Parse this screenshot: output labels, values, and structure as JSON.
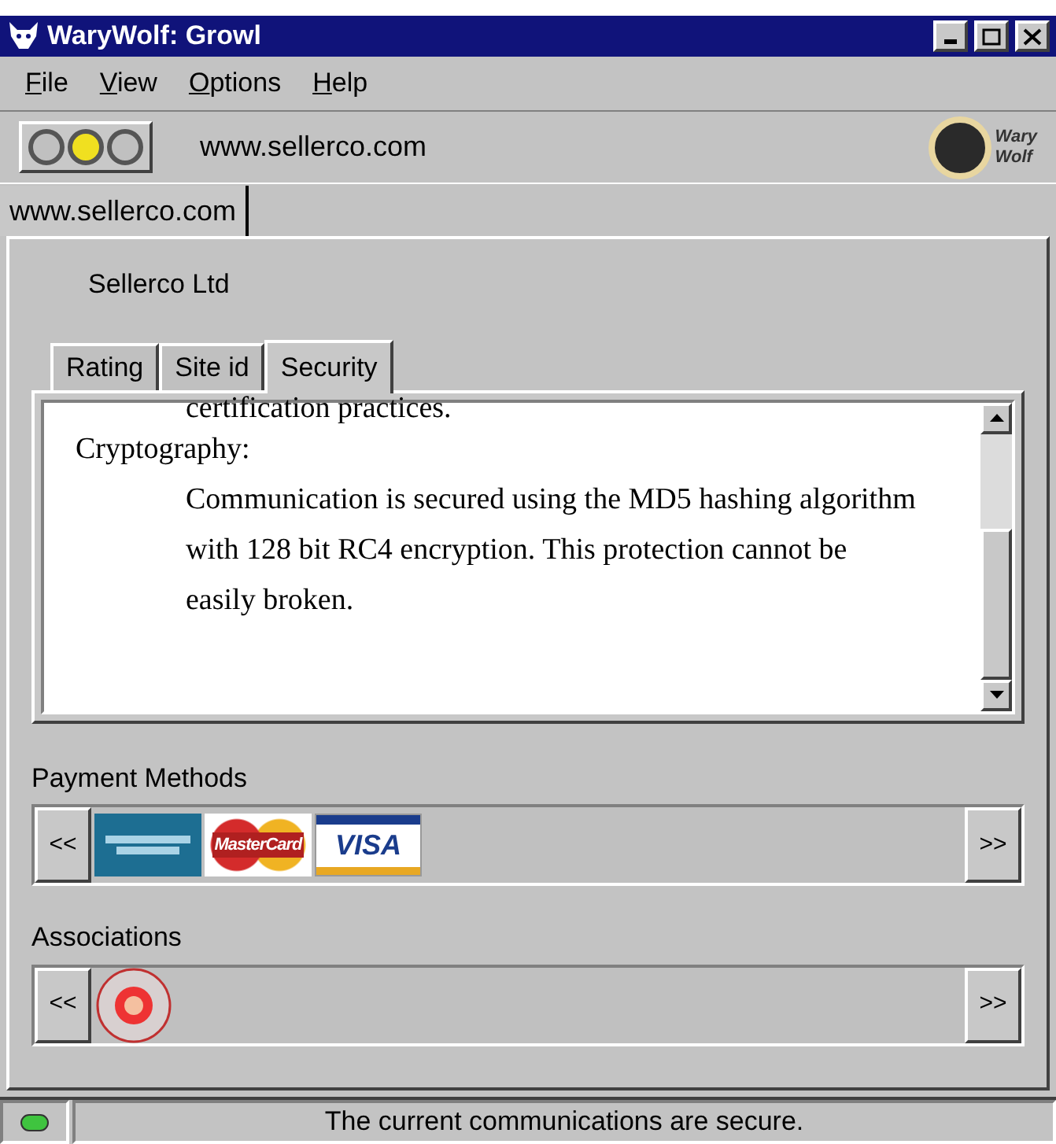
{
  "window": {
    "title": "WaryWolf: Growl"
  },
  "menu": [
    {
      "label": "File"
    },
    {
      "label": "View"
    },
    {
      "label": "Options"
    },
    {
      "label": "Help"
    }
  ],
  "toolbar": {
    "lights": [
      {
        "on": false
      },
      {
        "on": true
      },
      {
        "on": false
      }
    ],
    "url": "www.sellerco.com",
    "logo_text": [
      "Wary",
      "Wolf"
    ]
  },
  "site_tab": {
    "label": "www.sellerco.com"
  },
  "company": "Sellerco Ltd",
  "tabs": [
    {
      "label": "Rating",
      "selected": false
    },
    {
      "label": "Site id",
      "selected": false
    },
    {
      "label": "Security",
      "selected": true
    }
  ],
  "security": {
    "clipped_line": "certification practices.",
    "heading": "Cryptography:",
    "body": "Communication is secured using the MD5 hashing algorithm with 128 bit RC4 encryption. This protection cannot be easily broken."
  },
  "payment_methods": {
    "label": "Payment Methods",
    "prev": "<<",
    "next": ">>",
    "cards": [
      {
        "kind": "amex"
      },
      {
        "kind": "mastercard",
        "text": "MasterCard"
      },
      {
        "kind": "visa",
        "text": "VISA"
      }
    ]
  },
  "associations": {
    "label": "Associations",
    "prev": "<<",
    "next": ">>",
    "items": [
      {
        "kind": "seal"
      }
    ]
  },
  "status_bar": {
    "secure": true,
    "message": "The current communications are secure."
  }
}
